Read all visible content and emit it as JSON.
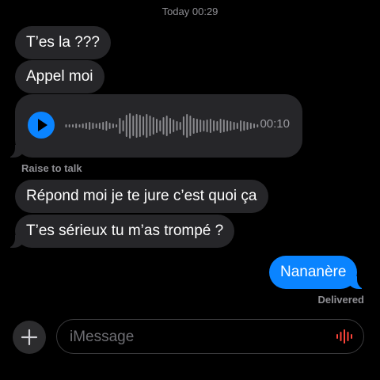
{
  "header": {
    "timestamp": "Today 00:29"
  },
  "messages": {
    "m1": "T’es la ???",
    "m2": "Appel moi",
    "m3": "Répond moi je te jure c’est quoi ça",
    "m4": "T’es sérieux tu m’as trompé ?",
    "m5": "Nananère"
  },
  "audio": {
    "duration": "00:10",
    "icon": "play-icon",
    "waveform_icon": "waveform-icon"
  },
  "labels": {
    "raise_to_talk": "Raise to talk",
    "delivered": "Delivered"
  },
  "composer": {
    "placeholder": "iMessage",
    "plus_icon": "plus-icon",
    "mic_icon": "audio-waveform-icon"
  },
  "colors": {
    "background": "#000000",
    "incoming_bubble": "#262629",
    "outgoing_bubble": "#0a84ff",
    "secondary_text": "#8e8e93",
    "mic_accent": "#ff453a"
  }
}
